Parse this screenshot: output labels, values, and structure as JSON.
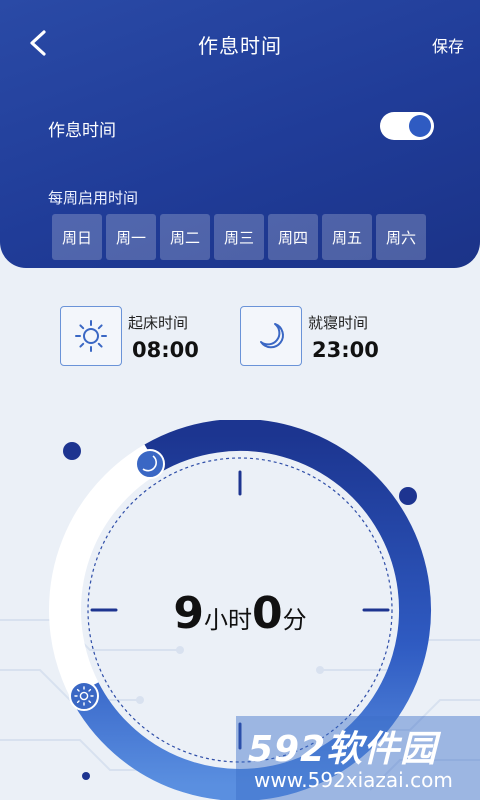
{
  "header": {
    "title": "作息时间",
    "save_label": "保存"
  },
  "schedule": {
    "toggle_label": "作息时间",
    "enabled": true,
    "week_label": "每周启用时间",
    "days": [
      "周日",
      "周一",
      "周二",
      "周三",
      "周四",
      "周五",
      "周六"
    ]
  },
  "wake": {
    "label": "起床时间",
    "time": "08:00",
    "icon": "sun-icon"
  },
  "bed": {
    "label": "就寝时间",
    "time": "23:00",
    "icon": "moon-icon"
  },
  "duration": {
    "hours": "9",
    "hours_unit": "小时",
    "minutes": "0",
    "minutes_unit": "分"
  },
  "watermark": {
    "brand": "592软件园",
    "url": "www.592xiazai.com"
  },
  "colors": {
    "primary": "#203c98",
    "accent": "#2f5bc2",
    "arc_light": "#5a8fe0"
  }
}
